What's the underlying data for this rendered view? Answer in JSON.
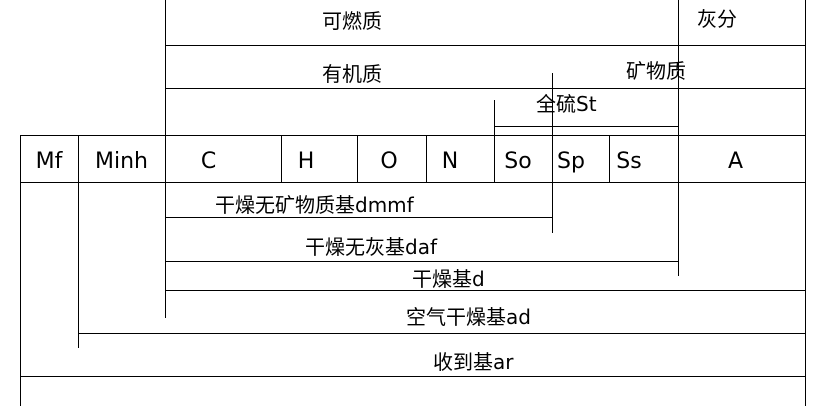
{
  "top_labels": {
    "combustible": "可燃质",
    "ash": "灰分",
    "organic": "有机质",
    "mineral": "矿物质",
    "total_sulfur": "全硫St"
  },
  "components": [
    "Mf",
    "Minh",
    "C",
    "H",
    "O",
    "N",
    "So",
    "Sp",
    "Ss",
    "A"
  ],
  "bases": {
    "dmmf": "干燥无矿物质基dmmf",
    "daf": "干燥无灰基daf",
    "d": "干燥基d",
    "ad": "空气干燥基ad",
    "ar": "收到基ar"
  }
}
